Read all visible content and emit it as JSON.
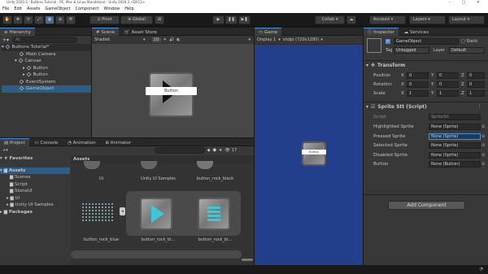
{
  "window": {
    "title": "Unity 2020.3 - Buttons Tutorial - PC, Mac & Linux Standalone - Unity 2020.3 <DX11>"
  },
  "menu": [
    "File",
    "Edit",
    "Assets",
    "GameObject",
    "Component",
    "Window",
    "Help"
  ],
  "toolbar": {
    "pivot": "Pivot",
    "global": "Global",
    "collab": "Collab",
    "account": "Account",
    "layers": "Layers",
    "layout": "Layout"
  },
  "hierarchy": {
    "tab": "Hierarchy",
    "search_placeholder": "All",
    "scene": "Buttons Tutorial*",
    "items": [
      "Main Camera",
      "Canvas",
      "Button",
      "Button",
      "EventSystem",
      "GameObject"
    ]
  },
  "scene": {
    "tab_scene": "Scene",
    "tab_asset_store": "Asset Store",
    "shading": "Shaded",
    "mode": "2D",
    "button_label": "Button"
  },
  "game": {
    "tab": "Game",
    "display": "Display 1",
    "resolution": "xhdpi (720x1280)",
    "button_label": "Button"
  },
  "inspector": {
    "tab": "Inspector",
    "tab_services": "Services",
    "name": "GameObject",
    "static": "Static",
    "tag_label": "Tag",
    "tag": "Untagged",
    "layer_label": "Layer",
    "layer": "Default",
    "transform": {
      "title": "Transform",
      "rows": [
        {
          "label": "Position",
          "x": "0",
          "y": "0",
          "z": "0"
        },
        {
          "label": "Rotation",
          "x": "0",
          "y": "0",
          "z": "0"
        },
        {
          "label": "Scale",
          "x": "1",
          "y": "1",
          "z": "1"
        }
      ]
    },
    "sprite_component": {
      "title": "Sprite Stt (Script)",
      "script_label": "Script",
      "script_value": "SpriteStt",
      "fields": [
        {
          "label": "Highlighted Sprite",
          "value": "None (Sprite)"
        },
        {
          "label": "Pressed Sprite",
          "value": "None (Sprite)"
        },
        {
          "label": "Selected Sprite",
          "value": "None (Sprite)"
        },
        {
          "label": "Disabled Sprite",
          "value": "None (Sprite)"
        },
        {
          "label": "Button",
          "value": "None (Button)"
        }
      ]
    },
    "add_component": "Add Component"
  },
  "project": {
    "tab_project": "Project",
    "tab_console": "Console",
    "tab_animation": "Animation",
    "tab_animator": "Animator",
    "count": "17",
    "favorites": "Favorites",
    "tree": [
      "Assets",
      "Scenes",
      "Script",
      "StoneUI",
      "UI",
      "Unity UI Samples",
      "Packages"
    ],
    "breadcrumb": "Assets",
    "row1": [
      "UI",
      "Unity UI Samples",
      "button_rock_black"
    ],
    "row2": [
      "button_rock_blue",
      "button_rock_bl...",
      "button_rock_bl..."
    ]
  },
  "colors": {
    "accent": "#4d8ed6",
    "game_bg": "#233f8c",
    "panel": "#383838"
  }
}
